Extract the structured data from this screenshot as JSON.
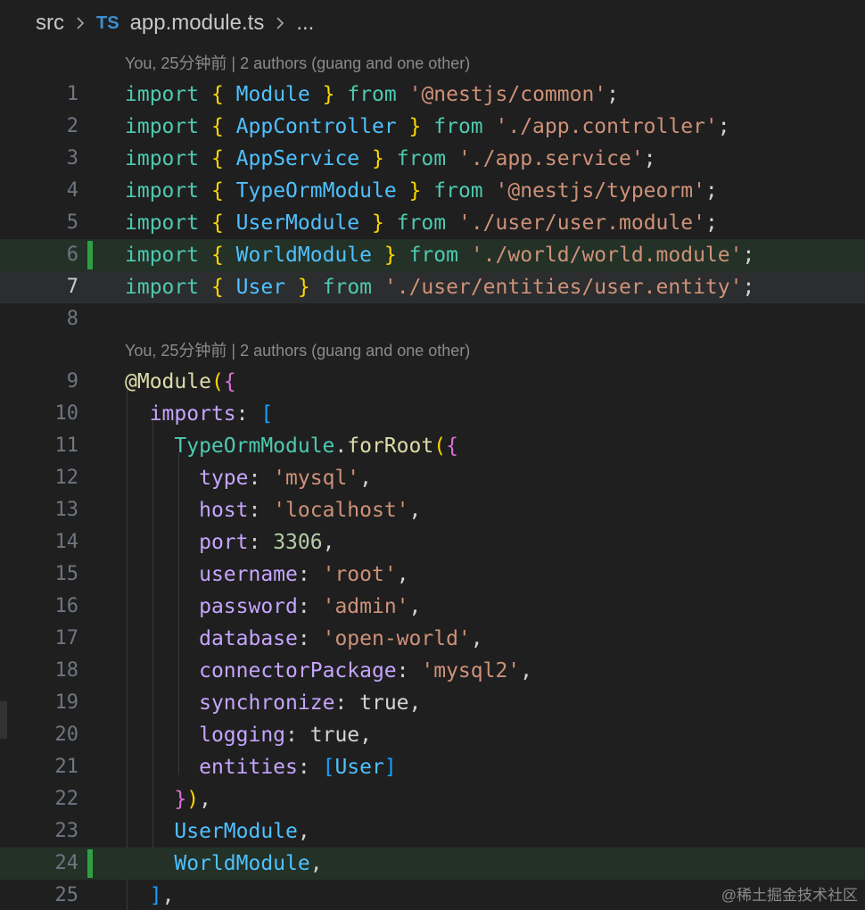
{
  "breadcrumb": {
    "folder": "src",
    "file_icon": "TS",
    "file": "app.module.ts",
    "more": "..."
  },
  "blame_lens": [
    "You, 25分钟前 | 2 authors (guang and one other)",
    "You, 25分钟前 | 2 authors (guang and one other)"
  ],
  "code_lines": [
    {
      "num": "1",
      "tokens": [
        [
          "import",
          "kw"
        ],
        [
          " ",
          "lit"
        ],
        [
          "{",
          "b1"
        ],
        [
          " ",
          "lit"
        ],
        [
          "Module",
          "mod"
        ],
        [
          " ",
          "lit"
        ],
        [
          "}",
          "b1"
        ],
        [
          " ",
          "lit"
        ],
        [
          "from",
          "kw"
        ],
        [
          " ",
          "lit"
        ],
        [
          "'@nestjs/common'",
          "str"
        ],
        [
          ";",
          "punc"
        ]
      ]
    },
    {
      "num": "2",
      "tokens": [
        [
          "import",
          "kw"
        ],
        [
          " ",
          "lit"
        ],
        [
          "{",
          "b1"
        ],
        [
          " ",
          "lit"
        ],
        [
          "AppController",
          "mod"
        ],
        [
          " ",
          "lit"
        ],
        [
          "}",
          "b1"
        ],
        [
          " ",
          "lit"
        ],
        [
          "from",
          "kw"
        ],
        [
          " ",
          "lit"
        ],
        [
          "'./app.controller'",
          "str"
        ],
        [
          ";",
          "punc"
        ]
      ]
    },
    {
      "num": "3",
      "tokens": [
        [
          "import",
          "kw"
        ],
        [
          " ",
          "lit"
        ],
        [
          "{",
          "b1"
        ],
        [
          " ",
          "lit"
        ],
        [
          "AppService",
          "mod"
        ],
        [
          " ",
          "lit"
        ],
        [
          "}",
          "b1"
        ],
        [
          " ",
          "lit"
        ],
        [
          "from",
          "kw"
        ],
        [
          " ",
          "lit"
        ],
        [
          "'./app.service'",
          "str"
        ],
        [
          ";",
          "punc"
        ]
      ]
    },
    {
      "num": "4",
      "tokens": [
        [
          "import",
          "kw"
        ],
        [
          " ",
          "lit"
        ],
        [
          "{",
          "b1"
        ],
        [
          " ",
          "lit"
        ],
        [
          "TypeOrmModule",
          "mod"
        ],
        [
          " ",
          "lit"
        ],
        [
          "}",
          "b1"
        ],
        [
          " ",
          "lit"
        ],
        [
          "from",
          "kw"
        ],
        [
          " ",
          "lit"
        ],
        [
          "'@nestjs/typeorm'",
          "str"
        ],
        [
          ";",
          "punc"
        ]
      ]
    },
    {
      "num": "5",
      "tokens": [
        [
          "import",
          "kw"
        ],
        [
          " ",
          "lit"
        ],
        [
          "{",
          "b1"
        ],
        [
          " ",
          "lit"
        ],
        [
          "UserModule",
          "mod"
        ],
        [
          " ",
          "lit"
        ],
        [
          "}",
          "b1"
        ],
        [
          " ",
          "lit"
        ],
        [
          "from",
          "kw"
        ],
        [
          " ",
          "lit"
        ],
        [
          "'./user/user.module'",
          "str"
        ],
        [
          ";",
          "punc"
        ]
      ]
    },
    {
      "num": "6",
      "tokens": [
        [
          "import",
          "kw"
        ],
        [
          " ",
          "lit"
        ],
        [
          "{",
          "b1"
        ],
        [
          " ",
          "lit"
        ],
        [
          "WorldModule",
          "mod"
        ],
        [
          " ",
          "lit"
        ],
        [
          "}",
          "b1"
        ],
        [
          " ",
          "lit"
        ],
        [
          "from",
          "kw"
        ],
        [
          " ",
          "lit"
        ],
        [
          "'./world/world.module'",
          "str"
        ],
        [
          ";",
          "punc"
        ]
      ]
    },
    {
      "num": "7",
      "tokens": [
        [
          "import",
          "kw"
        ],
        [
          " ",
          "lit"
        ],
        [
          "{",
          "b1"
        ],
        [
          " ",
          "lit"
        ],
        [
          "User",
          "mod"
        ],
        [
          " ",
          "lit"
        ],
        [
          "}",
          "b1"
        ],
        [
          " ",
          "lit"
        ],
        [
          "from",
          "kw"
        ],
        [
          " ",
          "lit"
        ],
        [
          "'./user/entities/user.entity'",
          "str"
        ],
        [
          ";",
          "punc"
        ]
      ]
    },
    {
      "num": "8",
      "tokens": []
    },
    {
      "num": "9",
      "tokens": [
        [
          "@",
          "fn"
        ],
        [
          "Module",
          "fn"
        ],
        [
          "(",
          "b1"
        ],
        [
          "{",
          "b2"
        ]
      ]
    },
    {
      "num": "10",
      "tokens": [
        [
          "  ",
          "lit"
        ],
        [
          "imports",
          "prop"
        ],
        [
          ":",
          "punc"
        ],
        [
          " ",
          "lit"
        ],
        [
          "[",
          "b3"
        ]
      ]
    },
    {
      "num": "11",
      "tokens": [
        [
          "    ",
          "lit"
        ],
        [
          "TypeOrmModule",
          "cls"
        ],
        [
          ".",
          "punc"
        ],
        [
          "forRoot",
          "fn"
        ],
        [
          "(",
          "b1"
        ],
        [
          "{",
          "b2"
        ]
      ]
    },
    {
      "num": "12",
      "tokens": [
        [
          "      ",
          "lit"
        ],
        [
          "type",
          "prop"
        ],
        [
          ":",
          "punc"
        ],
        [
          " ",
          "lit"
        ],
        [
          "'mysql'",
          "str"
        ],
        [
          ",",
          "punc"
        ]
      ]
    },
    {
      "num": "13",
      "tokens": [
        [
          "      ",
          "lit"
        ],
        [
          "host",
          "prop"
        ],
        [
          ":",
          "punc"
        ],
        [
          " ",
          "lit"
        ],
        [
          "'localhost'",
          "str"
        ],
        [
          ",",
          "punc"
        ]
      ]
    },
    {
      "num": "14",
      "tokens": [
        [
          "      ",
          "lit"
        ],
        [
          "port",
          "prop"
        ],
        [
          ":",
          "punc"
        ],
        [
          " ",
          "lit"
        ],
        [
          "3306",
          "num"
        ],
        [
          ",",
          "punc"
        ]
      ]
    },
    {
      "num": "15",
      "tokens": [
        [
          "      ",
          "lit"
        ],
        [
          "username",
          "prop"
        ],
        [
          ":",
          "punc"
        ],
        [
          " ",
          "lit"
        ],
        [
          "'root'",
          "str"
        ],
        [
          ",",
          "punc"
        ]
      ]
    },
    {
      "num": "16",
      "tokens": [
        [
          "      ",
          "lit"
        ],
        [
          "password",
          "prop"
        ],
        [
          ":",
          "punc"
        ],
        [
          " ",
          "lit"
        ],
        [
          "'admin'",
          "str"
        ],
        [
          ",",
          "punc"
        ]
      ]
    },
    {
      "num": "17",
      "tokens": [
        [
          "      ",
          "lit"
        ],
        [
          "database",
          "prop"
        ],
        [
          ":",
          "punc"
        ],
        [
          " ",
          "lit"
        ],
        [
          "'open-world'",
          "str"
        ],
        [
          ",",
          "punc"
        ]
      ]
    },
    {
      "num": "18",
      "tokens": [
        [
          "      ",
          "lit"
        ],
        [
          "connectorPackage",
          "prop"
        ],
        [
          ":",
          "punc"
        ],
        [
          " ",
          "lit"
        ],
        [
          "'mysql2'",
          "str"
        ],
        [
          ",",
          "punc"
        ]
      ]
    },
    {
      "num": "19",
      "tokens": [
        [
          "      ",
          "lit"
        ],
        [
          "synchronize",
          "prop"
        ],
        [
          ":",
          "punc"
        ],
        [
          " ",
          "lit"
        ],
        [
          "true",
          "lit"
        ],
        [
          ",",
          "punc"
        ]
      ]
    },
    {
      "num": "20",
      "tokens": [
        [
          "      ",
          "lit"
        ],
        [
          "logging",
          "prop"
        ],
        [
          ":",
          "punc"
        ],
        [
          " ",
          "lit"
        ],
        [
          "true",
          "lit"
        ],
        [
          ",",
          "punc"
        ]
      ]
    },
    {
      "num": "21",
      "tokens": [
        [
          "      ",
          "lit"
        ],
        [
          "entities",
          "prop"
        ],
        [
          ":",
          "punc"
        ],
        [
          " ",
          "lit"
        ],
        [
          "[",
          "b3"
        ],
        [
          "User",
          "mod"
        ],
        [
          "]",
          "b3"
        ]
      ]
    },
    {
      "num": "22",
      "tokens": [
        [
          "    ",
          "lit"
        ],
        [
          "}",
          "b2"
        ],
        [
          ")",
          "b1"
        ],
        [
          ",",
          "punc"
        ]
      ]
    },
    {
      "num": "23",
      "tokens": [
        [
          "    ",
          "lit"
        ],
        [
          "UserModule",
          "mod"
        ],
        [
          ",",
          "punc"
        ]
      ]
    },
    {
      "num": "24",
      "tokens": [
        [
          "    ",
          "lit"
        ],
        [
          "WorldModule",
          "mod"
        ],
        [
          ",",
          "punc"
        ]
      ]
    },
    {
      "num": "25",
      "tokens": [
        [
          "  ",
          "lit"
        ],
        [
          "]",
          "b3"
        ],
        [
          ",",
          "punc"
        ]
      ]
    }
  ],
  "added_lines": [
    "6",
    "24"
  ],
  "current_line": "7",
  "watermark": "@稀土掘金技术社区",
  "colors": {
    "background": "#1f1f1f",
    "added_gutter": "#2ea043",
    "keyword": "#4ec9b0",
    "string": "#ce9178",
    "property": "#c5a5ff"
  }
}
